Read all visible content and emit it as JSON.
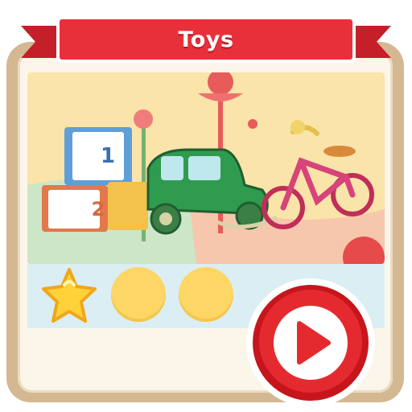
{
  "card": {
    "title": "Toys"
  },
  "scene": {
    "block_labels": [
      "1",
      "2"
    ]
  },
  "progress": {
    "stars_earned": 1,
    "stars_total": 3
  },
  "colors": {
    "ribbon": "#e8303a",
    "frame": "#d4b892",
    "star": "#ffd23a",
    "slot_empty": "#fdd666",
    "play_button": "#e52a2f"
  },
  "icons": {
    "star": "star-icon",
    "play": "play-icon"
  }
}
